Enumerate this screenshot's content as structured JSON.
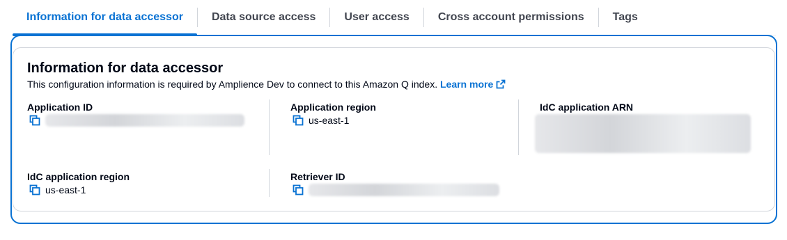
{
  "tabs": [
    {
      "label": "Information for data accessor",
      "active": true
    },
    {
      "label": "Data source access",
      "active": false
    },
    {
      "label": "User access",
      "active": false
    },
    {
      "label": "Cross account permissions",
      "active": false
    },
    {
      "label": "Tags",
      "active": false
    }
  ],
  "panel": {
    "title": "Information for data accessor",
    "description": "This configuration information is required by Amplience Dev to connect to this Amazon Q index.",
    "learn_more": "Learn more",
    "learn_more_icon": "external-link-icon"
  },
  "fields": {
    "application_id": {
      "label": "Application ID",
      "value": "",
      "redacted": true
    },
    "application_region": {
      "label": "Application region",
      "value": "us-east-1"
    },
    "idc_application_arn": {
      "label": "IdC application ARN",
      "value": "",
      "redacted": true
    },
    "idc_application_region": {
      "label": "IdC application region",
      "value": "us-east-1"
    },
    "retriever_id": {
      "label": "Retriever ID",
      "value": "",
      "redacted": true
    }
  },
  "colors": {
    "accent": "#0972d3",
    "text": "#000716",
    "tab_inactive": "#424650",
    "divider": "#d1d5db"
  },
  "icons": {
    "copy": "copy-icon",
    "external": "external-link-icon"
  }
}
